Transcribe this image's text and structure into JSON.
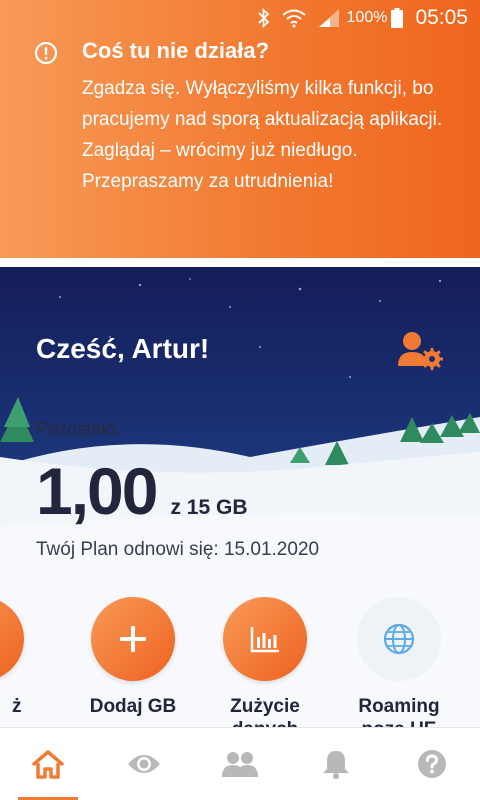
{
  "status_bar": {
    "battery": "100%",
    "time": "05:05",
    "icons": [
      "bluetooth-icon",
      "wifi-icon",
      "signal-icon",
      "battery-icon"
    ]
  },
  "banner": {
    "icon": "alert-circle-icon",
    "title": "Coś tu nie działa?",
    "body": "Zgadza się. Wyłączyliśmy kilka funkcji, bo pracujemy nad sporą aktualizacją aplikacji. Zaglądaj – wrócimy już niedługo. Przepraszamy za utrudnienia!"
  },
  "header": {
    "greeting": "Cześć, Artur!",
    "profile_icon": "user-settings-icon"
  },
  "data_plan": {
    "remaining_label": "Pozostało:",
    "amount": "1,00",
    "amount_of": "z 15 GB",
    "renew_text": "Twój Plan odnowi się: 15.01.2020"
  },
  "actions": [
    {
      "label": "ż",
      "icon": "partial-action-icon"
    },
    {
      "label": "Dodaj GB",
      "icon": "plus-icon"
    },
    {
      "label": "Zużycie danych",
      "icon": "bar-chart-icon"
    },
    {
      "label": "Roaming poza UE",
      "icon": "globe-icon"
    }
  ],
  "bottom_nav": [
    {
      "name": "home",
      "icon": "home-icon",
      "active": true
    },
    {
      "name": "view",
      "icon": "eye-icon",
      "active": false
    },
    {
      "name": "users",
      "icon": "users-icon",
      "active": false
    },
    {
      "name": "notifications",
      "icon": "bell-icon",
      "active": false
    },
    {
      "name": "help",
      "icon": "help-icon",
      "active": false
    }
  ],
  "colors": {
    "accent": "#f27a31",
    "text_dark": "#22263c",
    "sky_top": "#141d58",
    "inactive_icon": "#b8b8b8"
  }
}
